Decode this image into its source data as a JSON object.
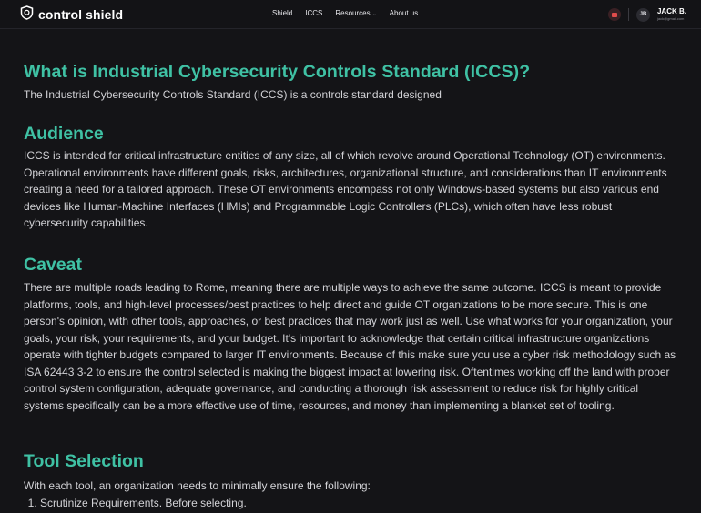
{
  "brand": {
    "name": "control shield"
  },
  "nav": {
    "items": [
      {
        "label": "Shield",
        "dropdown": false
      },
      {
        "label": "ICCS",
        "dropdown": false
      },
      {
        "label": "Resources",
        "dropdown": true
      },
      {
        "label": "About us",
        "dropdown": false
      }
    ]
  },
  "user": {
    "initials": "JB",
    "name": "JACK B.",
    "email": "jack@gmail.com"
  },
  "icons": {
    "logo": "shield-icon",
    "notification": "notification-icon",
    "dropdown": "chevron-down-icon"
  },
  "colors": {
    "accent": "#3fc1a4",
    "background": "#141417",
    "text": "#d2d2d6",
    "notification": "#e24b4b"
  },
  "sections": {
    "intro": {
      "title": "What is Industrial Cybersecurity Controls Standard (ICCS)?",
      "body": "The Industrial Cybersecurity Controls Standard (ICCS) is a controls standard designed"
    },
    "audience": {
      "title": "Audience",
      "body": "ICCS is intended for critical infrastructure entities of any size, all of which revolve around Operational Technology (OT) environments. Operational environments have different goals, risks, architectures, organizational structure, and considerations than IT environments creating a need for a tailored approach. These OT environments encompass not only Windows-based systems but also various end devices like Human-Machine Interfaces (HMIs) and Programmable Logic Controllers (PLCs), which often have less robust cybersecurity capabilities."
    },
    "caveat": {
      "title": "Caveat",
      "body": "There are multiple roads leading to Rome, meaning there are multiple ways to achieve the same outcome. ICCS is meant to provide platforms, tools, and high-level processes/best practices to help direct and guide OT organizations to be more secure. This is one person's opinion, with other tools, approaches, or best practices that may work just as well. Use what works for your organization, your goals, your risk, your requirements, and your budget. It's important to acknowledge that certain critical infrastructure organizations operate with tighter budgets compared to larger IT environments. Because of this make sure you use a cyber risk methodology such as ISA 62443 3-2 to ensure the control selected is making the biggest impact at lowering risk. Oftentimes working off the land with proper control system configuration, adequate governance, and conducting a thorough risk assessment to reduce risk for highly critical systems specifically can be a more effective use of time, resources, and money than implementing a blanket set of tooling."
    },
    "tool_selection": {
      "title": "Tool Selection",
      "body": "With each tool, an organization needs to minimally ensure the following:",
      "list": [
        "Scrutinize Requirements. Before selecting."
      ]
    }
  }
}
